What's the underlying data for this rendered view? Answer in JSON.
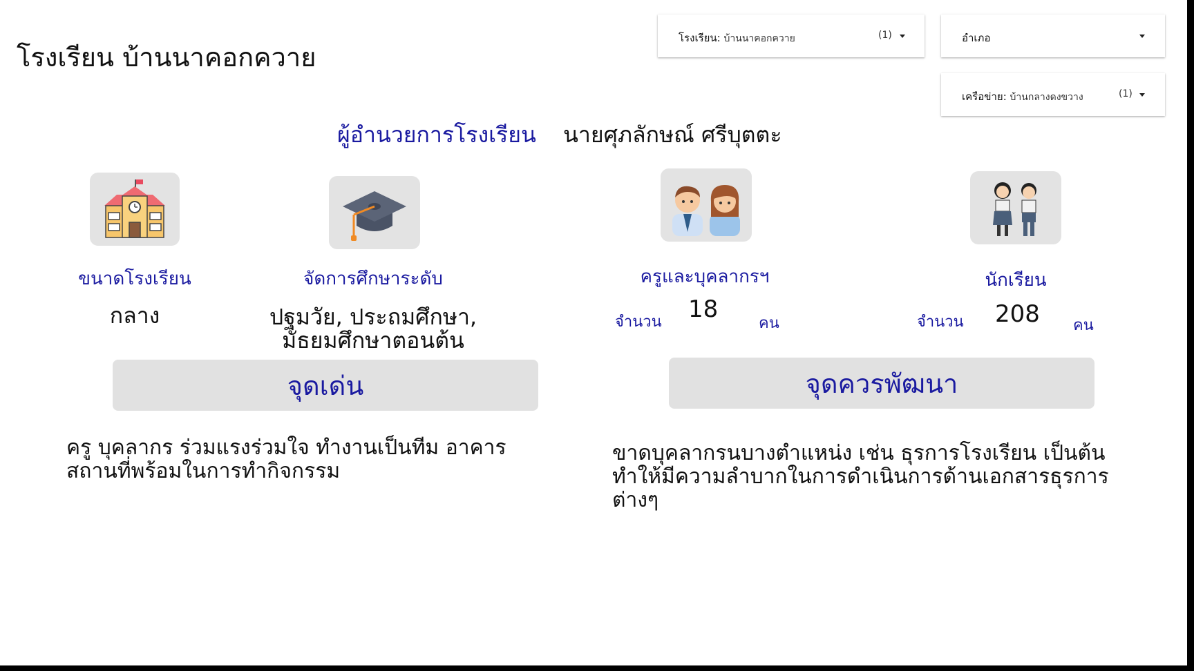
{
  "header": {
    "school_title": "โรงเรียน บ้านนาคอกควาย"
  },
  "filters": {
    "school": {
      "label": "โรงเรียน",
      "value": "บ้านนาคอกควาย",
      "count": "(1)"
    },
    "district": {
      "label": "อำเภอ"
    },
    "network": {
      "label": "เครือข่าย",
      "value": "บ้านกลางดงขวาง",
      "count": "(1)"
    }
  },
  "director": {
    "label": "ผู้อำนวยการโรงเรียน",
    "name": "นายศุภลักษณ์ ศรีบุตตะ"
  },
  "stats": {
    "size": {
      "icon": "school-building-icon",
      "label": "ขนาดโรงเรียน",
      "value": "กลาง"
    },
    "level": {
      "icon": "graduation-cap-icon",
      "label": "จัดการศึกษาระดับ",
      "value_line1": "ปฐมวัย, ประถมศึกษา,",
      "value_line2": "มัธยมศึกษาตอนต้น"
    },
    "staff": {
      "icon": "teachers-icon",
      "label": "ครูและบุคลากรฯ",
      "prefix": "จำนวน",
      "count": "18",
      "unit": "คน"
    },
    "students": {
      "icon": "students-icon",
      "label": "นักเรียน",
      "prefix": "จำนวน",
      "count": "208",
      "unit": "คน"
    }
  },
  "strengths": {
    "title": "จุดเด่น",
    "line1": "ครู บุคลากร ร่วมแรงร่วมใจ ทำงานเป็นทีม อาคาร",
    "line2": "สถานที่พร้อมในการทำกิจกรรม"
  },
  "improvements": {
    "title": "จุดควรพัฒนา",
    "line1": "ขาดบุคลากรนบางตำแหน่ง เช่น ธุรการโรงเรียน เป็นต้น",
    "line2": "ทำให้มีความลำบากในการดำเนินการด้านเอกสารธุรการ",
    "line3": "ต่างๆ"
  },
  "colors": {
    "accent_blue": "#1a1aa0",
    "panel_gray": "#e1e1e1"
  }
}
